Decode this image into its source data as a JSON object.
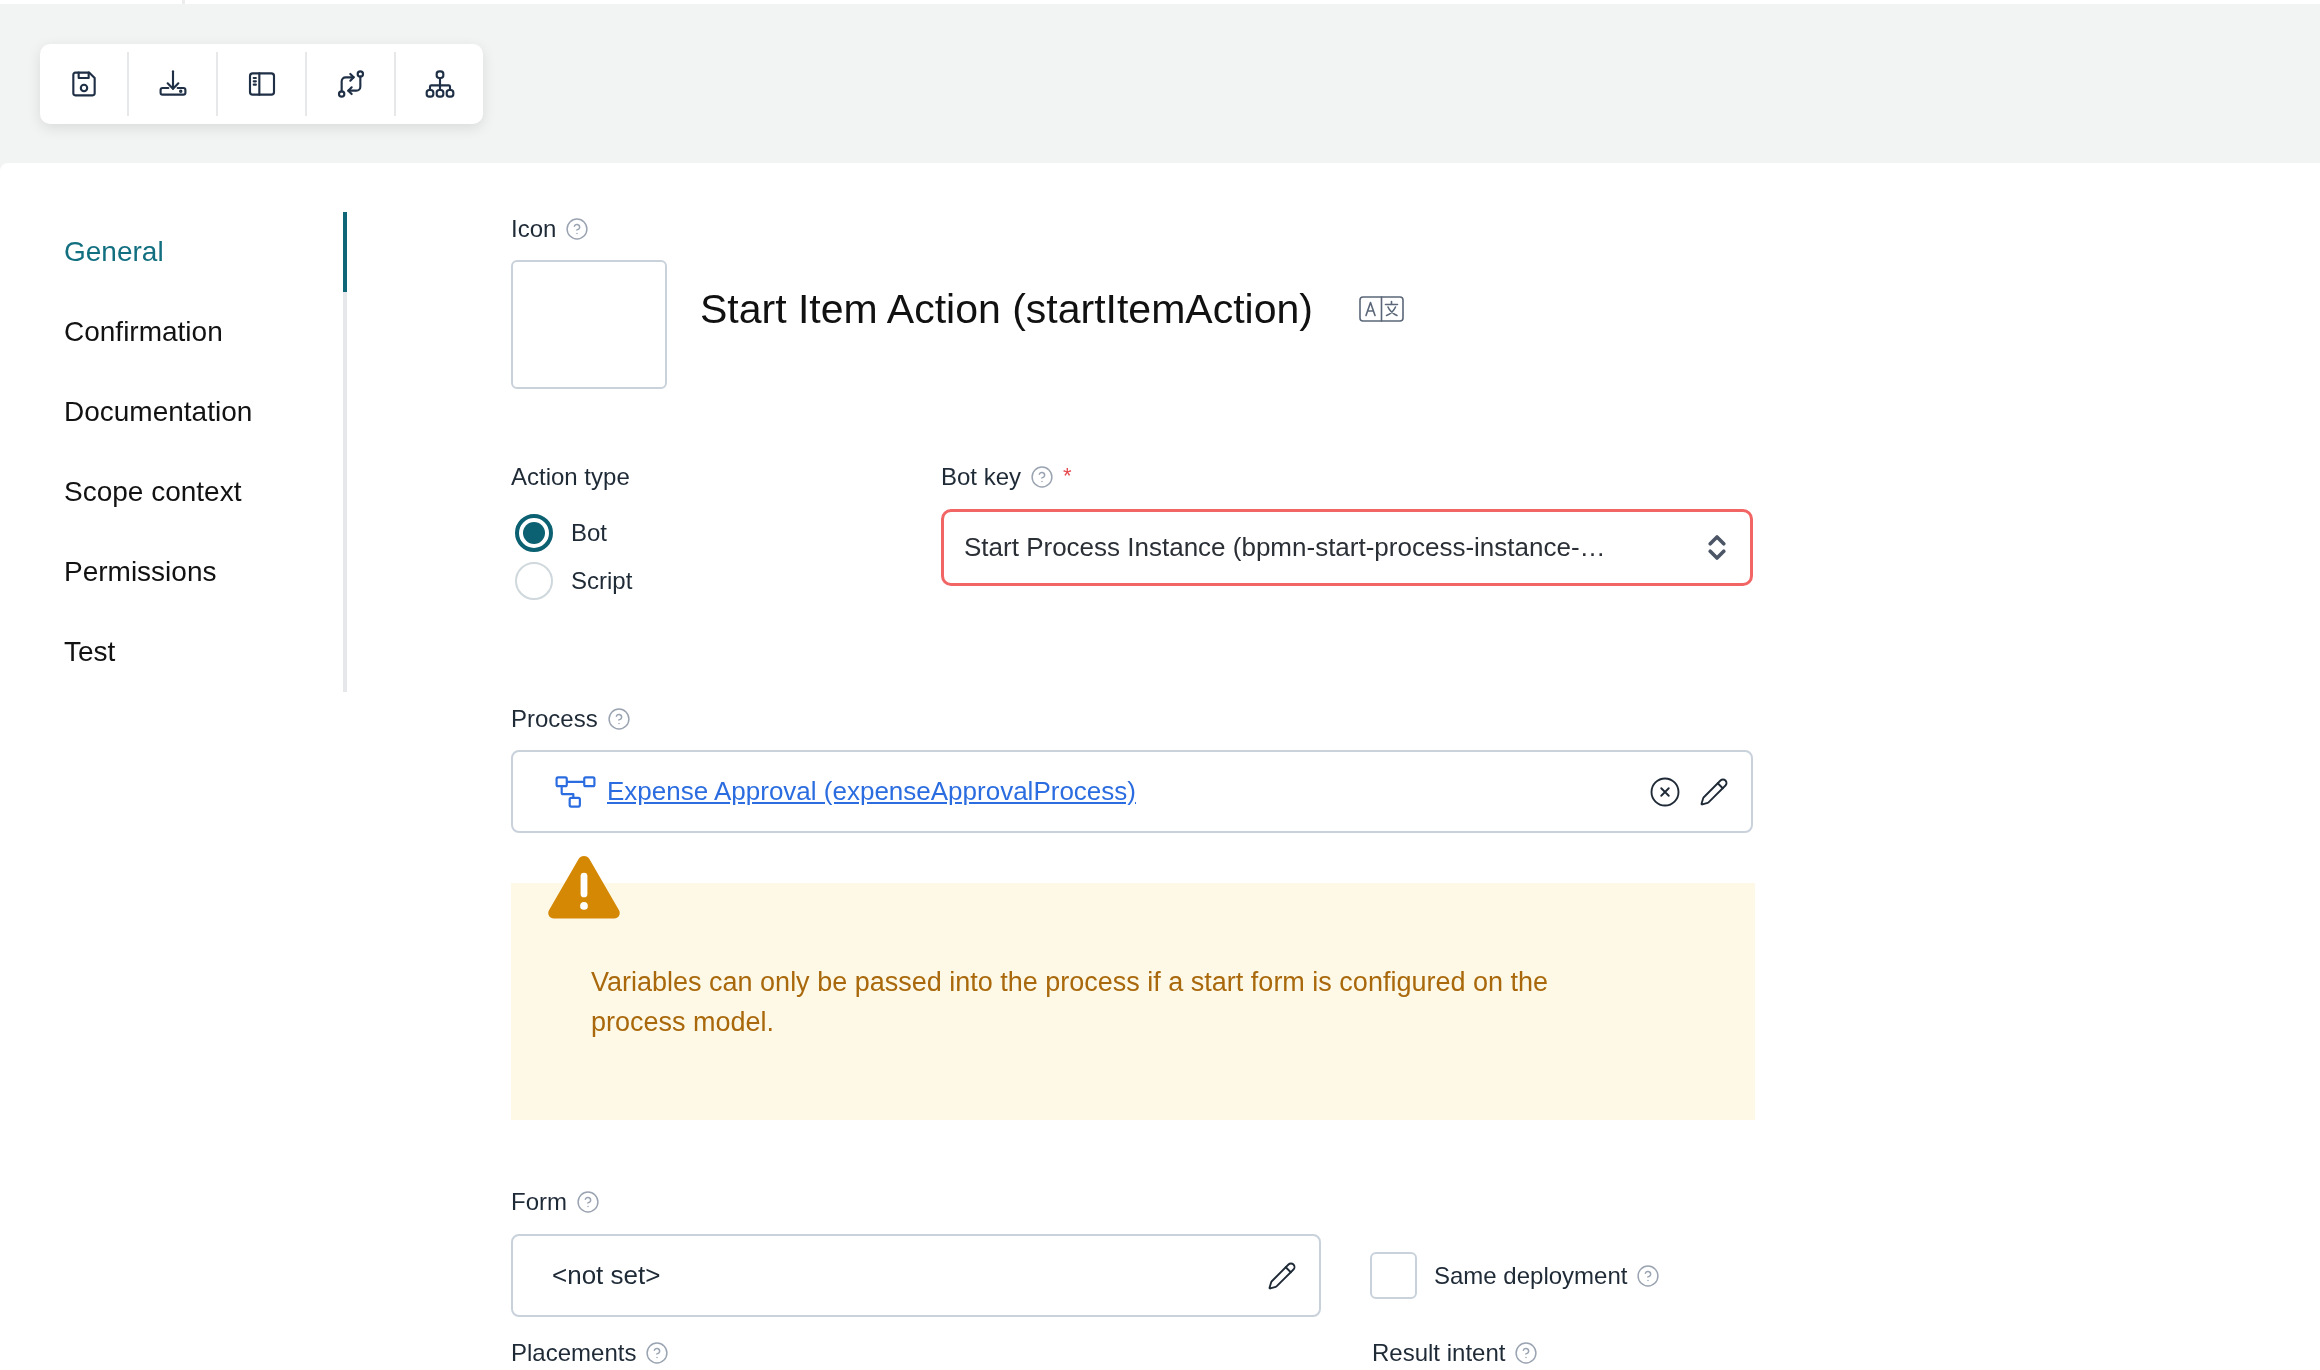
{
  "sidebar": {
    "items": [
      {
        "label": "General",
        "selected": true
      },
      {
        "label": "Confirmation",
        "selected": false
      },
      {
        "label": "Documentation",
        "selected": false
      },
      {
        "label": "Scope context",
        "selected": false
      },
      {
        "label": "Permissions",
        "selected": false
      },
      {
        "label": "Test",
        "selected": false
      }
    ]
  },
  "icon": {
    "label": "Icon"
  },
  "title": "Start Item Action (startItemAction)",
  "action_type": {
    "label": "Action type",
    "options": [
      {
        "label": "Bot",
        "selected": true
      },
      {
        "label": "Script",
        "selected": false
      }
    ]
  },
  "bot_key": {
    "label": "Bot key",
    "required_mark": "*",
    "value": "Start Process Instance (bpmn-start-process-instance-…",
    "invalid": true
  },
  "process": {
    "label": "Process",
    "value": "Expense Approval (expenseApprovalProcess)"
  },
  "warning": {
    "text": "Variables can only be passed into the process if a start form is configured on the process model."
  },
  "form": {
    "label": "Form",
    "value": "<not set>"
  },
  "same_deployment": {
    "label": "Same deployment",
    "checked": false
  },
  "placements": {
    "label": "Placements"
  },
  "result_intent": {
    "label": "Result intent"
  }
}
